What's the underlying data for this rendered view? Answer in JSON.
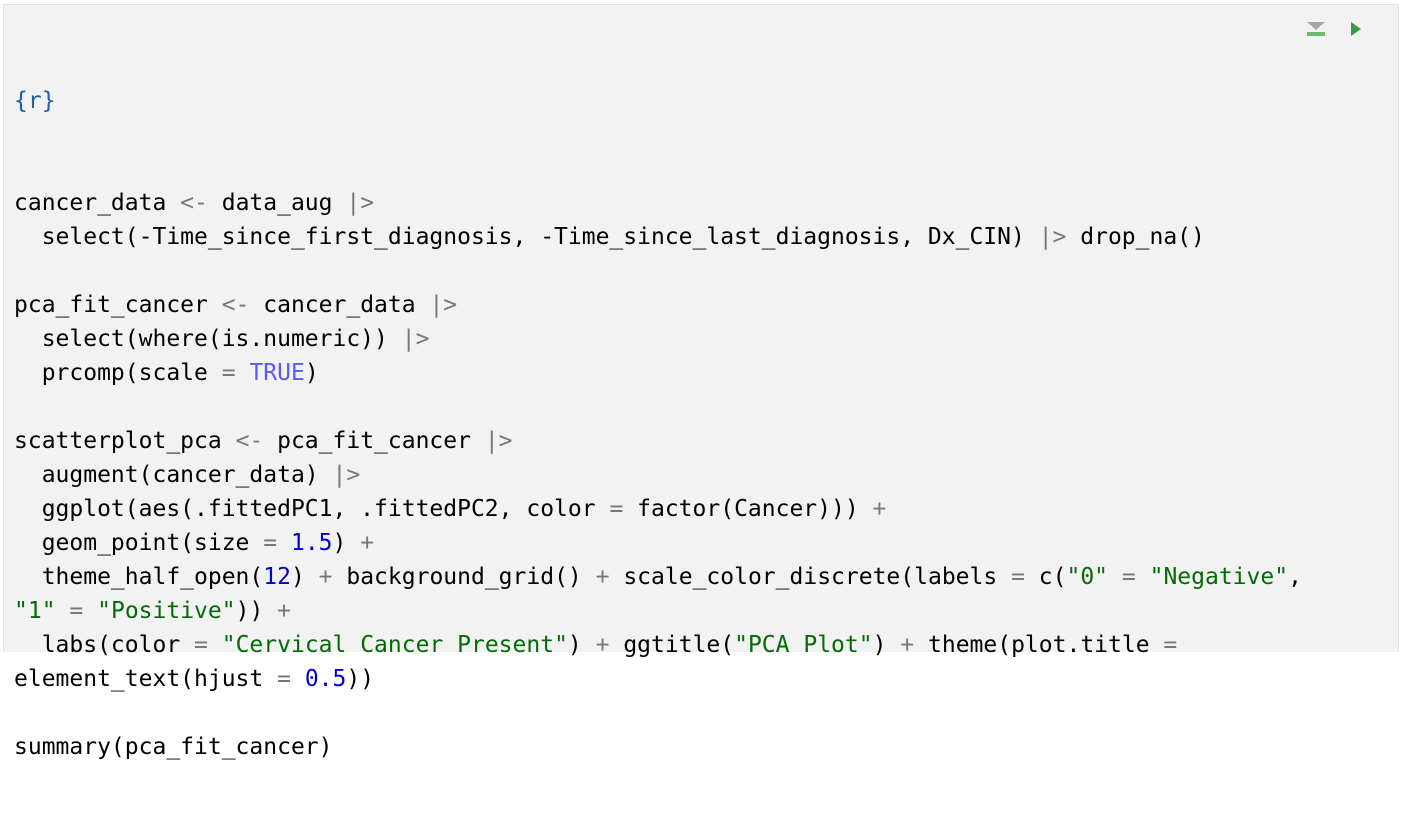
{
  "chunk": {
    "header": "{r}",
    "tools": [
      {
        "name": "run-chunks-above",
        "icon": "run-above-icon",
        "color": "#7ab870"
      },
      {
        "name": "run-chunk",
        "icon": "play-icon",
        "color": "#3d9b3d"
      }
    ],
    "code_lines": [
      "cancer_data <- data_aug |>",
      "  select(-Time_since_first_diagnosis, -Time_since_last_diagnosis, Dx_CIN) |> drop_na()",
      "",
      "pca_fit_cancer <- cancer_data |>",
      "  select(where(is.numeric)) |>",
      "  prcomp(scale = TRUE)",
      "",
      "scatterplot_pca <- pca_fit_cancer |>",
      "  augment(cancer_data) |>",
      "  ggplot(aes(.fittedPC1, .fittedPC2, color = factor(Cancer))) +",
      "  geom_point(size = 1.5) +",
      "  theme_half_open(12) + background_grid() + scale_color_discrete(labels = c(\"0\" = \"Negative\",",
      "\"1\" = \"Positive\")) +",
      "  labs(color = \"Cervical Cancer Present\") + ggtitle(\"PCA Plot\") + theme(plot.title =",
      "element_text(hjust = 0.5))",
      "",
      "summary(pca_fit_cancer)"
    ]
  },
  "colors": {
    "background": "#f2f2f2",
    "operator": "#777777",
    "string": "#036a07",
    "number": "#0000cd",
    "keyword": "#585cf6"
  }
}
